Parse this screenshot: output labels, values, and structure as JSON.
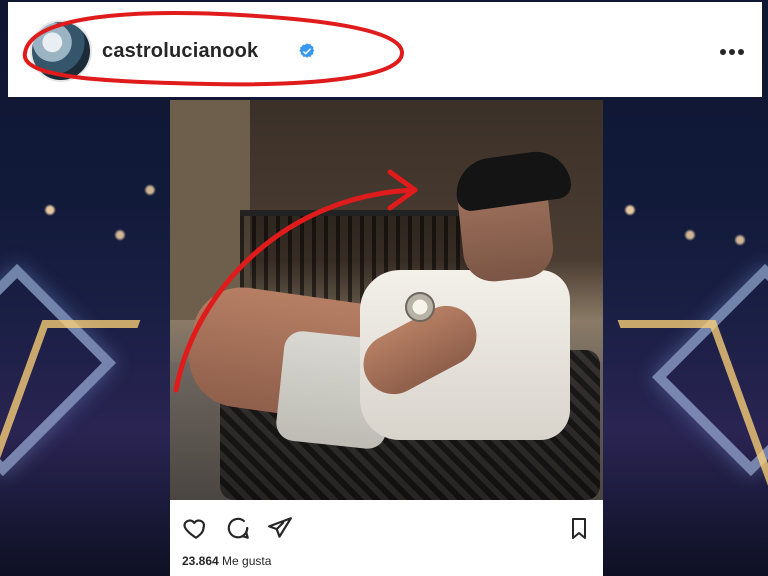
{
  "header": {
    "username": "castrolucianook",
    "verified_icon": "verified-badge-icon",
    "more_icon": "more-horizontal-icon"
  },
  "post": {
    "likes_count": "23.864",
    "likes_label": "Me gusta"
  },
  "actions": {
    "like_icon": "heart-icon",
    "comment_icon": "comment-icon",
    "share_icon": "send-icon",
    "save_icon": "bookmark-icon"
  },
  "colors": {
    "ig_text": "#262626",
    "verified_blue": "#3897f0",
    "highlight_red": "#e01b1b"
  }
}
